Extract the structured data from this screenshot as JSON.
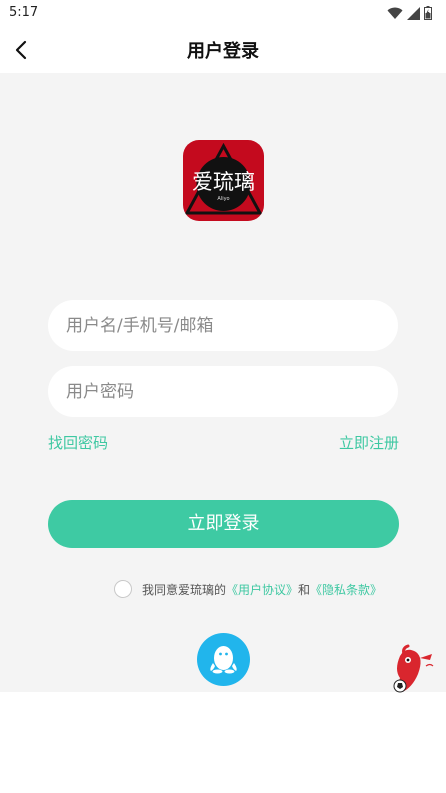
{
  "status_bar": {
    "time": "5:17"
  },
  "header": {
    "title": "用户登录"
  },
  "logo": {
    "text": "爱琉璃",
    "subtext": "Aliyo"
  },
  "form": {
    "username_placeholder": "用户名/手机号/邮箱",
    "password_placeholder": "用户密码",
    "forgot_password": "找回密码",
    "register": "立即注册",
    "login_button": "立即登录"
  },
  "agreement": {
    "prefix": "我同意爱琉璃的",
    "user_agreement": "《用户协议》",
    "and": "和",
    "privacy_policy": "《隐私条款》"
  },
  "colors": {
    "accent": "#3ecaa3",
    "logo_red": "#c40a1e",
    "qq_blue": "#21b5ec"
  },
  "icons": [
    "back-arrow-icon",
    "wifi-icon",
    "signal-icon",
    "battery-icon",
    "qq-penguin-icon",
    "mascot-icon"
  ]
}
